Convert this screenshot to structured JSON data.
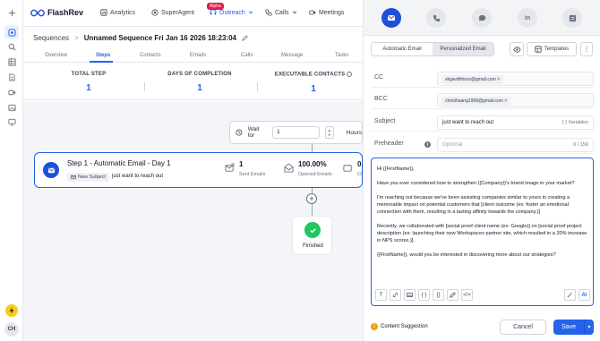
{
  "rail": {
    "avatar": "CH"
  },
  "brand": {
    "name": "FlashRev"
  },
  "nav": {
    "analytics": "Analytics",
    "superagent": "SuperAgent",
    "superagent_badge": "Alpha",
    "outreach": "Outreach",
    "calls": "Calls",
    "meetings": "Meetings"
  },
  "breadcrumb": {
    "parent": "Sequences",
    "sep": ">",
    "current": "Unnamed Sequence Fri Jan 16 2026 18:23:04"
  },
  "tabs": {
    "overview": "Overview",
    "steps": "Steps",
    "contacts": "Contacts",
    "emails": "Emails",
    "calls": "Calls",
    "message": "Message",
    "tasks": "Tasks"
  },
  "stats": {
    "total_label": "TOTAL STEP",
    "total_value": "1",
    "days_label": "DAYS OF COMPLETION",
    "days_value": "1",
    "exec_label": "EXECUTABLE CONTACTS",
    "exec_value": "1"
  },
  "wait": {
    "label": "Wait for",
    "value": "1",
    "unit": "Hours"
  },
  "step": {
    "title": "Step 1 - Automatic Email - Day 1",
    "subject_tag": "New Subject",
    "subject": "just want to reach out",
    "sent_value": "1",
    "sent_label": "Sent Emails",
    "opened_value": "100.00%",
    "opened_label": "Opened Emails",
    "clicked_value": "0.0",
    "clicked_label": "Clic"
  },
  "finished": {
    "label": "Finished"
  },
  "panel": {
    "linkedin_label": "in",
    "mode_auto": "Automatic Email",
    "mode_personal": "Personalized Email",
    "templates": "Templates",
    "more": "⋮",
    "cc_label": "CC",
    "cc_chip": "vkgsvdhhsce@gmail.com",
    "bcc_label": "BCC",
    "bcc_chip": "christhuang1999@gmail.com",
    "subject_label": "Subject",
    "subject_value": "just want to reach out",
    "variables": "{ } Variables",
    "preheader_label": "Preheader",
    "preheader_placeholder": "Optional",
    "preheader_count": "0 / 150",
    "body": [
      "Hi {{FirstName}},",
      "Have you ever considered how to strengthen {{Company}}'s brand image in your market?",
      "I'm reaching out because we've been assisting companies similar to yours in creating a memorable impact on potential customers that [client outcome (ex: foster an emotional connection with them, resulting in a lasting affinity towards the company.)]",
      "Recently, we collaborated with [social proof client name (ex: Google)] on [social proof project description (ex: launching their new Workspaces partner site, which resulted in a 20% increase in NPS scores.)].",
      "{{FirstName}}, would you be interested in discovering more about our strategies?"
    ],
    "content_suggestion": "Content Suggestion",
    "cancel": "Cancel",
    "save": "Save"
  },
  "colors": {
    "accent": "#2563eb",
    "brand_dark": "#1e4fd8",
    "success": "#22c55e",
    "alpha_badge": "#e11d48"
  },
  "icons": [
    "plus-icon",
    "sequence-icon",
    "search-icon",
    "table-icon",
    "document-icon",
    "video-icon",
    "image-icon",
    "monitor-icon",
    "bolt-icon",
    "analytics-icon",
    "superagent-icon",
    "outreach-icon",
    "calls-icon",
    "meetings-icon",
    "edit-icon",
    "clock-icon",
    "mail-icon",
    "phone-icon",
    "chat-icon",
    "linkedin-icon",
    "task-icon",
    "eye-icon",
    "template-icon",
    "check-icon"
  ]
}
